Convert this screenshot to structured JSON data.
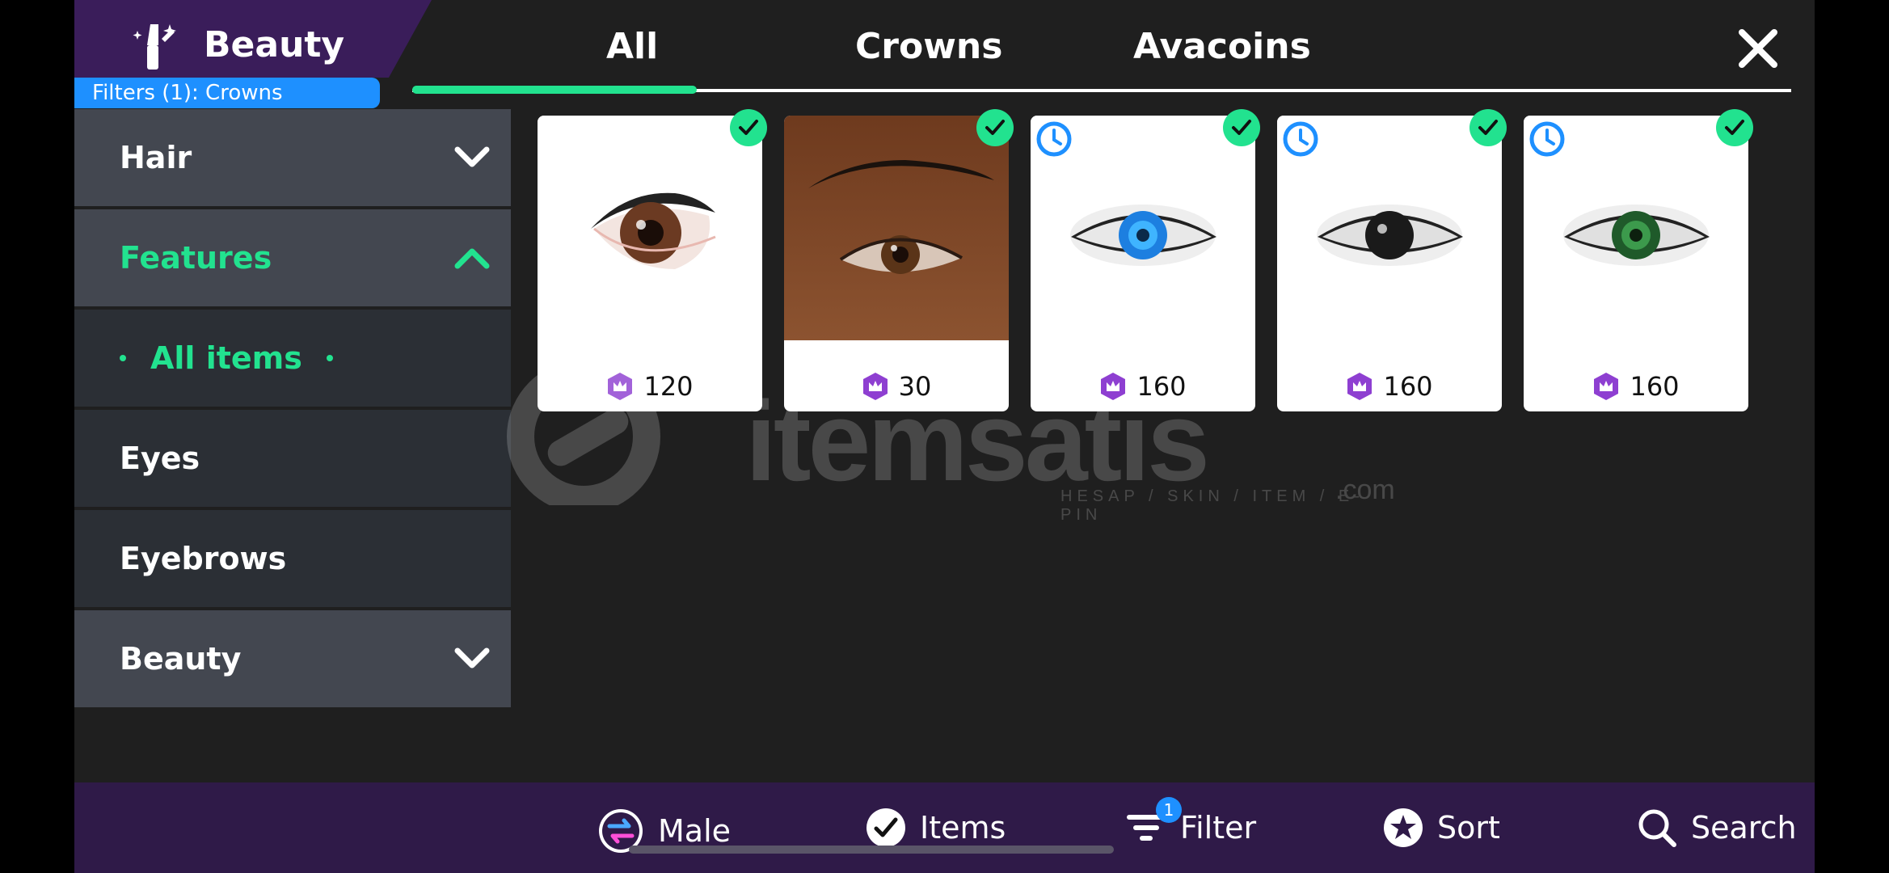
{
  "header": {
    "category_title": "Beauty",
    "filter_pill": "Filters (1): Crowns"
  },
  "tabs": [
    "All",
    "Crowns",
    "Avacoins"
  ],
  "sidebar": {
    "items": [
      {
        "label": "Hair"
      },
      {
        "label": "Features"
      },
      {
        "label": "All items"
      },
      {
        "label": "Eyes"
      },
      {
        "label": "Eyebrows"
      },
      {
        "label": "Beauty"
      }
    ]
  },
  "items": [
    {
      "price": "120",
      "owned": true,
      "timed": false,
      "preview": "brown-eye-white"
    },
    {
      "price": "30",
      "owned": true,
      "timed": false,
      "preview": "brown-eye-skin"
    },
    {
      "price": "160",
      "owned": true,
      "timed": true,
      "preview": "blue-eye"
    },
    {
      "price": "160",
      "owned": true,
      "timed": true,
      "preview": "black-eye"
    },
    {
      "price": "160",
      "owned": true,
      "timed": true,
      "preview": "green-eye"
    }
  ],
  "bottom_bar": {
    "male": "Male",
    "items": "Items",
    "filter": "Filter",
    "filter_badge": "1",
    "sort": "Sort",
    "search": "Search"
  },
  "watermark": {
    "brand": "itemsatis",
    "tagline": "HESAP / SKIN / ITEM / E-PIN",
    "domain": ".com"
  },
  "colors": {
    "accent": "#22e28f",
    "purple": "#3a1d5a",
    "blue": "#1e90ff"
  }
}
